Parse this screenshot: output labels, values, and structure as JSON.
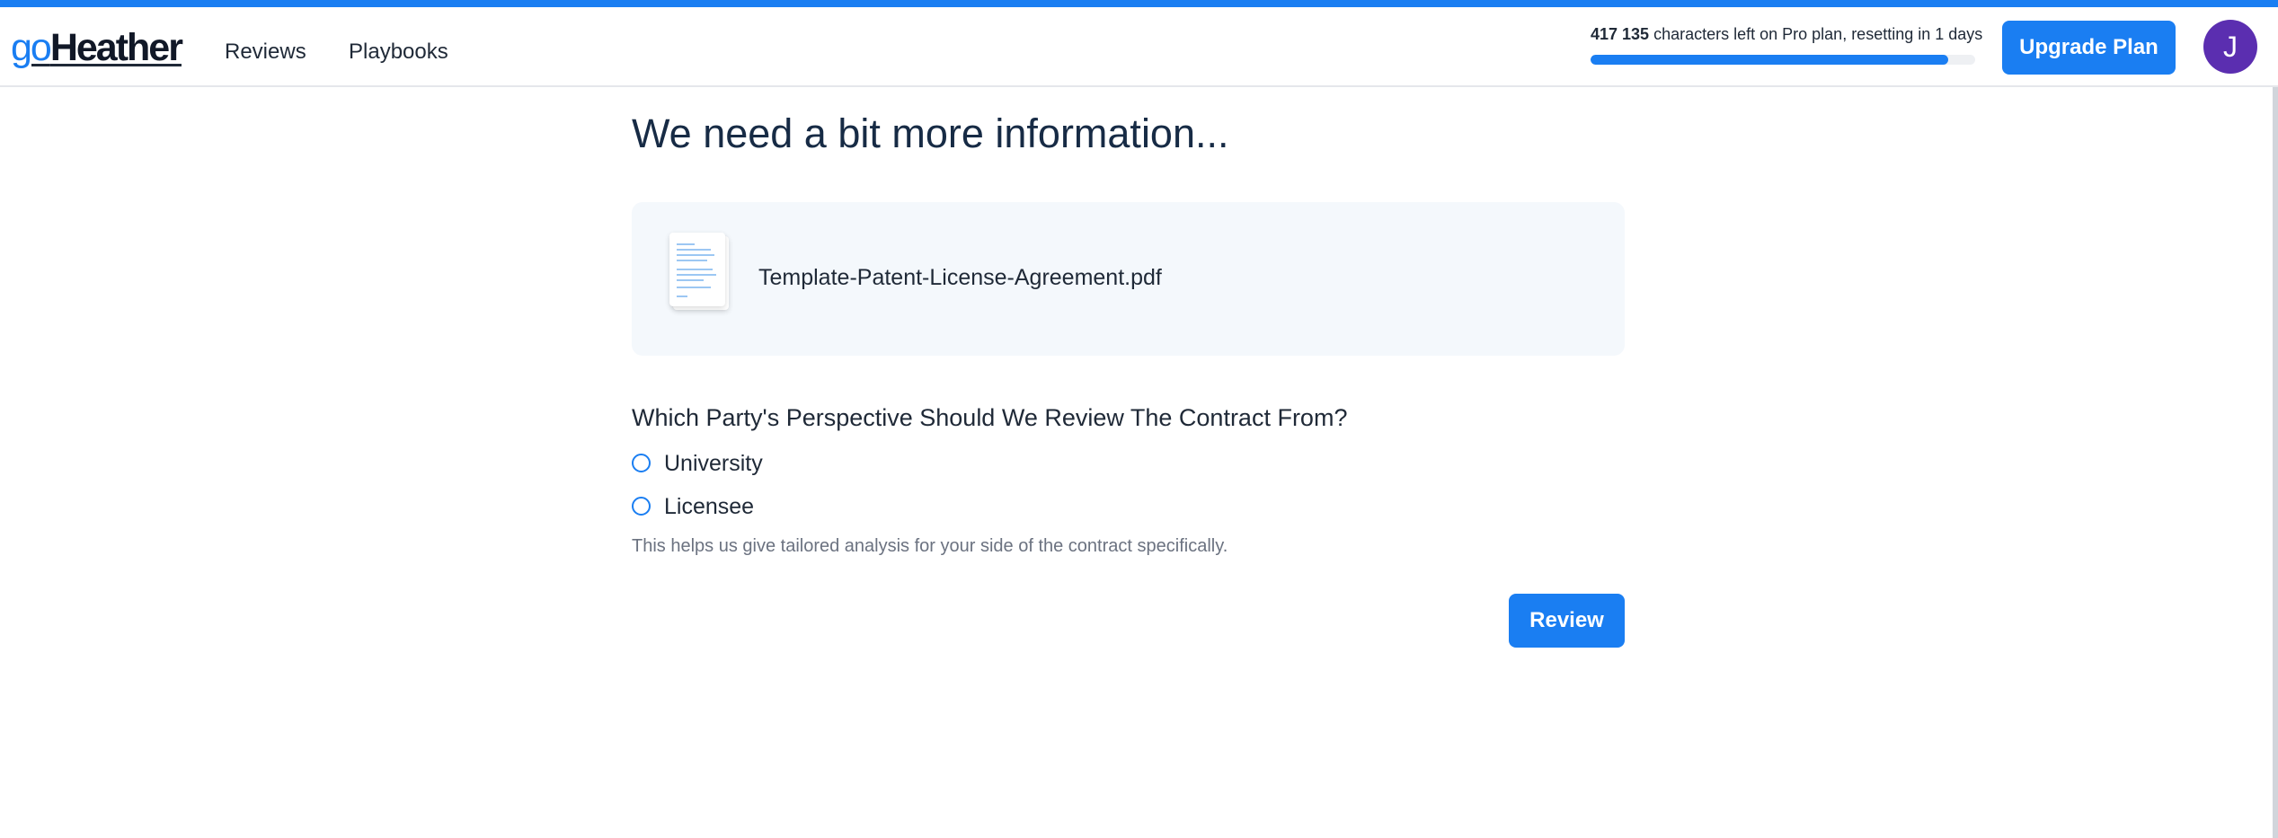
{
  "header": {
    "logo_prefix": "go",
    "logo_brand": "Heather",
    "nav": [
      {
        "label": "Reviews"
      },
      {
        "label": "Playbooks"
      }
    ],
    "usage": {
      "count": "417 135",
      "text": " characters left on Pro plan, resetting in 1 days",
      "progress_percent": 93
    },
    "upgrade_label": "Upgrade Plan",
    "avatar_initial": "J"
  },
  "main": {
    "title": "We need a bit more information...",
    "file": {
      "name": "Template-Patent-License-Agreement.pdf",
      "icon": "document-thumbnail-icon"
    },
    "question": "Which Party's Perspective Should We Review The Contract From?",
    "options": [
      {
        "label": "University",
        "selected": false
      },
      {
        "label": "Licensee",
        "selected": false
      }
    ],
    "hint": "This helps us give tailored analysis for your side of the contract specifically.",
    "review_label": "Review"
  },
  "colors": {
    "accent": "#1a7ef2",
    "avatar": "#5b2eb0",
    "title": "#172b45",
    "card_bg": "#f4f8fc"
  }
}
